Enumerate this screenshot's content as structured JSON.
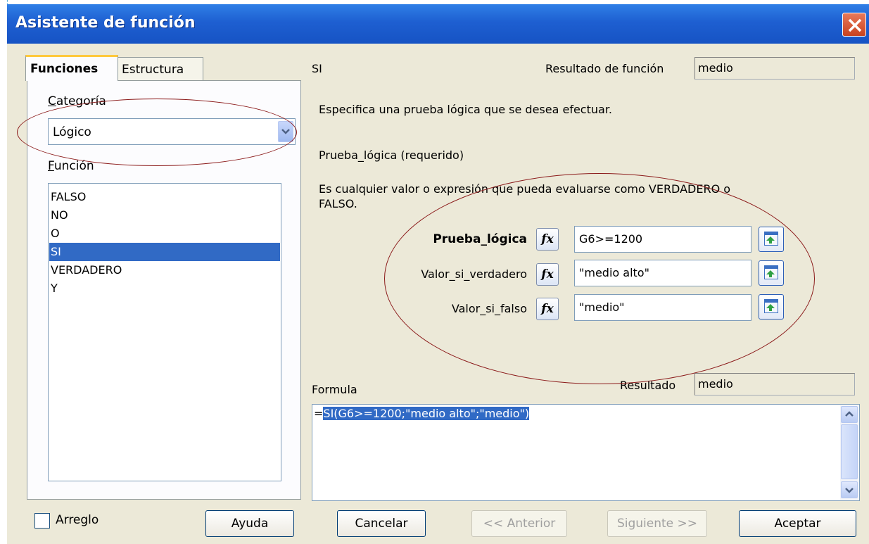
{
  "window": {
    "title": "Asistente de función"
  },
  "tabs": [
    {
      "label": "Funciones",
      "active": true
    },
    {
      "label": "Estructura",
      "active": false
    }
  ],
  "left": {
    "category_label": "Categoría",
    "category_value": "Lógico",
    "function_label": "Función",
    "functions": [
      "FALSO",
      "NO",
      "O",
      "SI",
      "VERDADERO",
      "Y"
    ],
    "selected_function": "SI"
  },
  "right": {
    "function_name": "SI",
    "result_label": "Resultado de función",
    "result_value": "medio",
    "description": "Especifica una prueba lógica que se desea efectuar.",
    "param_title": "Prueba_lógica (requerido)",
    "param_description_line1": "Es cualquier valor o expresión que pueda evaluarse como VERDADERO o",
    "param_description_line2": "FALSO.",
    "args": [
      {
        "label": "Prueba_lógica",
        "value": "G6>=1200",
        "bold": true
      },
      {
        "label": "Valor_si_verdadero",
        "value": "\"medio alto\"",
        "bold": false
      },
      {
        "label": "Valor_si_falso",
        "value": "\"medio\"",
        "bold": false
      }
    ],
    "formula_label": "Formula",
    "formula_result_label": "Resultado",
    "formula_result_value": "medio",
    "formula_prefix": "=",
    "formula_selected": "SI(G6>=1200;\"medio alto\";\"medio\")"
  },
  "footer": {
    "array_label": "Arreglo",
    "help": "Ayuda",
    "cancel": "Cancelar",
    "previous": "<< Anterior",
    "next": "Siguiente >>",
    "ok": "Aceptar"
  },
  "colors": {
    "titlebar": "#1e5fd1",
    "selection": "#316ac5",
    "annotation_ellipse": "#8b1a1a",
    "dialog_bg": "#ece9d8"
  }
}
